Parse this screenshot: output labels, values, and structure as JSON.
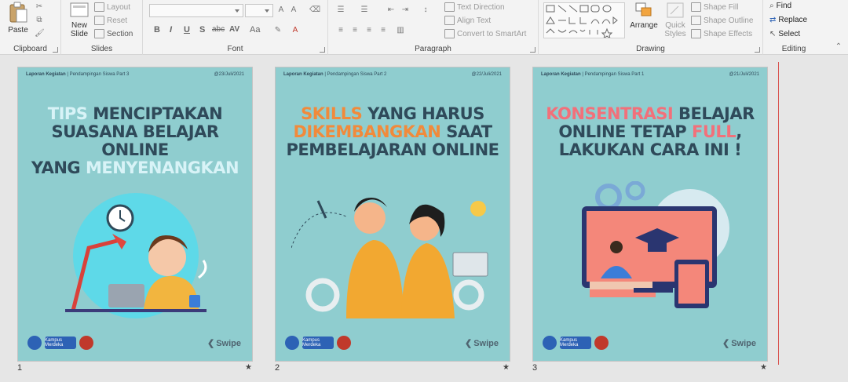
{
  "ribbon": {
    "clipboard": {
      "paste": "Paste",
      "label": "Clipboard"
    },
    "slides": {
      "new_slide": "New",
      "new_slide_2": "Slide",
      "layout": "Layout",
      "reset": "Reset",
      "section": "Section",
      "label": "Slides"
    },
    "font": {
      "label": "Font",
      "bold": "B",
      "italic": "I",
      "underline": "U",
      "strike": "S",
      "abc": "abc",
      "spacing": "AV",
      "case": "Aa"
    },
    "paragraph": {
      "text_direction": "Text Direction",
      "align_text": "Align Text",
      "convert_smartart": "Convert to SmartArt",
      "label": "Paragraph"
    },
    "drawing": {
      "arrange": "Arrange",
      "quick_styles": "Quick",
      "quick_styles_2": "Styles",
      "shape_fill": "Shape Fill",
      "shape_outline": "Shape Outline",
      "shape_effects": "Shape Effects",
      "label": "Drawing"
    },
    "editing": {
      "find": "Find",
      "replace": "Replace",
      "select": "Select",
      "label": "Editing"
    }
  },
  "slides": [
    {
      "number": "1",
      "header_left_bold": "Laporan Kegiatan",
      "header_left_rest": "| Pendampingan Siswa Part 3",
      "header_right": "@23/Juli/2021",
      "title_l1_hl": "TIPS",
      "title_l1_rest": "MENCIPTAKAN",
      "title_l2": "SUASANA BELAJAR ONLINE",
      "title_l3_a": "YANG",
      "title_l3_hl": "MENYENANGKAN",
      "logo_km": "Kampus Merdeka",
      "swipe": "Swipe"
    },
    {
      "number": "2",
      "header_left_bold": "Laporan Kegiatan",
      "header_left_rest": "| Pendampingan Siswa Part 2",
      "header_right": "@22/Juli/2021",
      "title_l1_hl": "SKILLS",
      "title_l1_rest": "YANG HARUS",
      "title_l2_hl": "DIKEMBANGKAN",
      "title_l2_rest": "SAAT",
      "title_l3": "PEMBELAJARAN ONLINE",
      "logo_km": "Kampus Merdeka",
      "swipe": "Swipe"
    },
    {
      "number": "3",
      "header_left_bold": "Laporan Kegiatan",
      "header_left_rest": "| Pendampingan Siswa Part 1",
      "header_right": "@21/Juli/2021",
      "title_l1_hl": "KONSENTRASI",
      "title_l1_rest": "BELAJAR",
      "title_l2_a": "ONLINE TETAP",
      "title_l2_hl": "FULL",
      "title_l2_b": ",",
      "title_l3": "LAKUKAN CARA INI !",
      "logo_km": "Kampus Merdeka",
      "swipe": "Swipe"
    }
  ],
  "slide_star": "★",
  "colors": {
    "slide_bg": "#8fcdcf",
    "title": "#2f4a5a",
    "orange": "#f18a3b",
    "pink": "#f2707a",
    "light": "#d8f3f7"
  }
}
